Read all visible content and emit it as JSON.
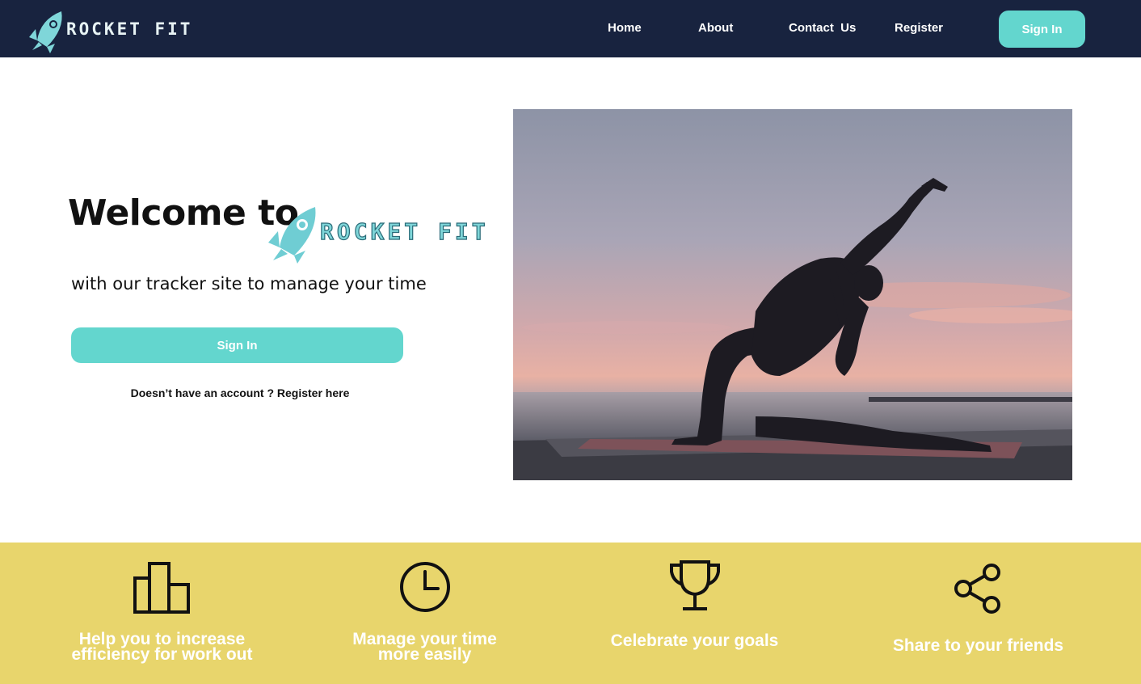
{
  "nav": {
    "brand": "ROCKET FIT",
    "links": [
      "Home",
      "About",
      "Contact  Us",
      "Register"
    ],
    "signin_label": "Sign In"
  },
  "hero": {
    "welcome": "Welcome to",
    "brand": "ROCKET FIT",
    "tagline": "with our tracker site to manage your time",
    "signin_label": "Sign In",
    "register_question": "Doesn’t have an account ?",
    "register_link": "Register here",
    "image_icon": "yoga-silhouette-sunset-photo"
  },
  "features": [
    {
      "icon": "bar-chart-icon",
      "label_line1": "Help you to increase",
      "label_line2": "efficiency for work out"
    },
    {
      "icon": "clock-icon",
      "label_line1": "Manage your time",
      "label_line2": "more easily"
    },
    {
      "icon": "trophy-icon",
      "label_line1": "Celebrate your goals",
      "label_line2": ""
    },
    {
      "icon": "share-icon",
      "label_line1": "Share to your friends",
      "label_line2": ""
    }
  ],
  "colors": {
    "navbar": "#18233f",
    "accent": "#63d6ce",
    "features_bg": "#e8d56c",
    "brand_teal": "#7fd6d9"
  }
}
